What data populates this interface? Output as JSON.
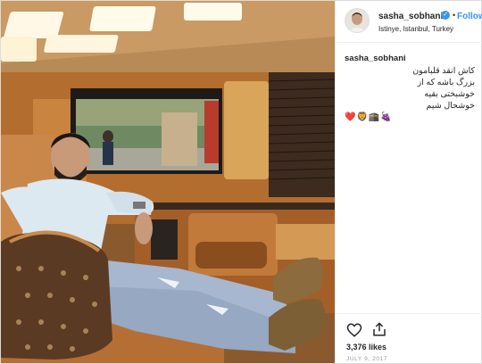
{
  "post": {
    "photo_icon": "photo-of-man-in-luxury-van",
    "header": {
      "username": "sasha_sobhani",
      "verified_icon": "verified-badge-icon",
      "separator": "•",
      "follow_label": "Follow",
      "location": "Istinye, Istanbul, Turkey"
    },
    "caption": {
      "username": "sasha_sobhani",
      "lines": [
        "کاش انقد قلبامون",
        "بزرگ باشه که از",
        "خوشبختی بقیه",
        "خوشحال شیم"
      ],
      "emoji": "❤️🦁🕋🍇"
    },
    "actions": {
      "like_icon": "heart-icon",
      "share_icon": "share-icon"
    },
    "likes": "3,376 likes",
    "date": "JULY 9, 2017",
    "colors": {
      "accent": "#3897f0",
      "text": "#262626",
      "muted": "#999999"
    }
  }
}
